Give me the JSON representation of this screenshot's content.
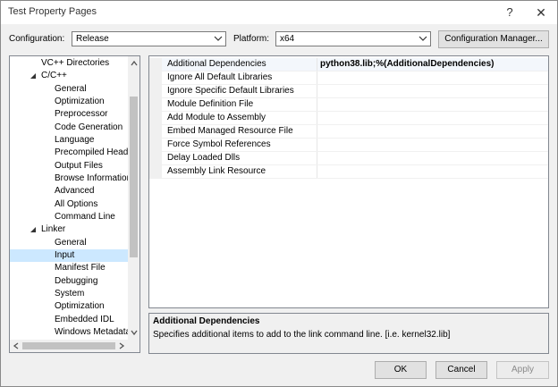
{
  "window": {
    "title": "Test Property Pages",
    "help_glyph": "?",
    "close_glyph": "✕"
  },
  "toolbar": {
    "configuration_label": "Configuration:",
    "configuration_value": "Release",
    "platform_label": "Platform:",
    "platform_value": "x64",
    "config_manager_label": "Configuration Manager..."
  },
  "tree": {
    "items": [
      {
        "label": "VC++ Directories"
      },
      {
        "label": "C/C++"
      },
      {
        "label": "General"
      },
      {
        "label": "Optimization"
      },
      {
        "label": "Preprocessor"
      },
      {
        "label": "Code Generation"
      },
      {
        "label": "Language"
      },
      {
        "label": "Precompiled Headers"
      },
      {
        "label": "Output Files"
      },
      {
        "label": "Browse Information"
      },
      {
        "label": "Advanced"
      },
      {
        "label": "All Options"
      },
      {
        "label": "Command Line"
      },
      {
        "label": "Linker"
      },
      {
        "label": "General"
      },
      {
        "label": "Input"
      },
      {
        "label": "Manifest File"
      },
      {
        "label": "Debugging"
      },
      {
        "label": "System"
      },
      {
        "label": "Optimization"
      },
      {
        "label": "Embedded IDL"
      },
      {
        "label": "Windows Metadata"
      }
    ]
  },
  "properties": [
    {
      "name": "Additional Dependencies",
      "value": "python38.lib;%(AdditionalDependencies)"
    },
    {
      "name": "Ignore All Default Libraries",
      "value": ""
    },
    {
      "name": "Ignore Specific Default Libraries",
      "value": ""
    },
    {
      "name": "Module Definition File",
      "value": ""
    },
    {
      "name": "Add Module to Assembly",
      "value": ""
    },
    {
      "name": "Embed Managed Resource File",
      "value": ""
    },
    {
      "name": "Force Symbol References",
      "value": ""
    },
    {
      "name": "Delay Loaded Dlls",
      "value": ""
    },
    {
      "name": "Assembly Link Resource",
      "value": ""
    }
  ],
  "description": {
    "title": "Additional Dependencies",
    "text": "Specifies additional items to add to the link command line. [i.e. kernel32.lib]"
  },
  "buttons": {
    "ok": "OK",
    "cancel": "Cancel",
    "apply": "Apply"
  }
}
